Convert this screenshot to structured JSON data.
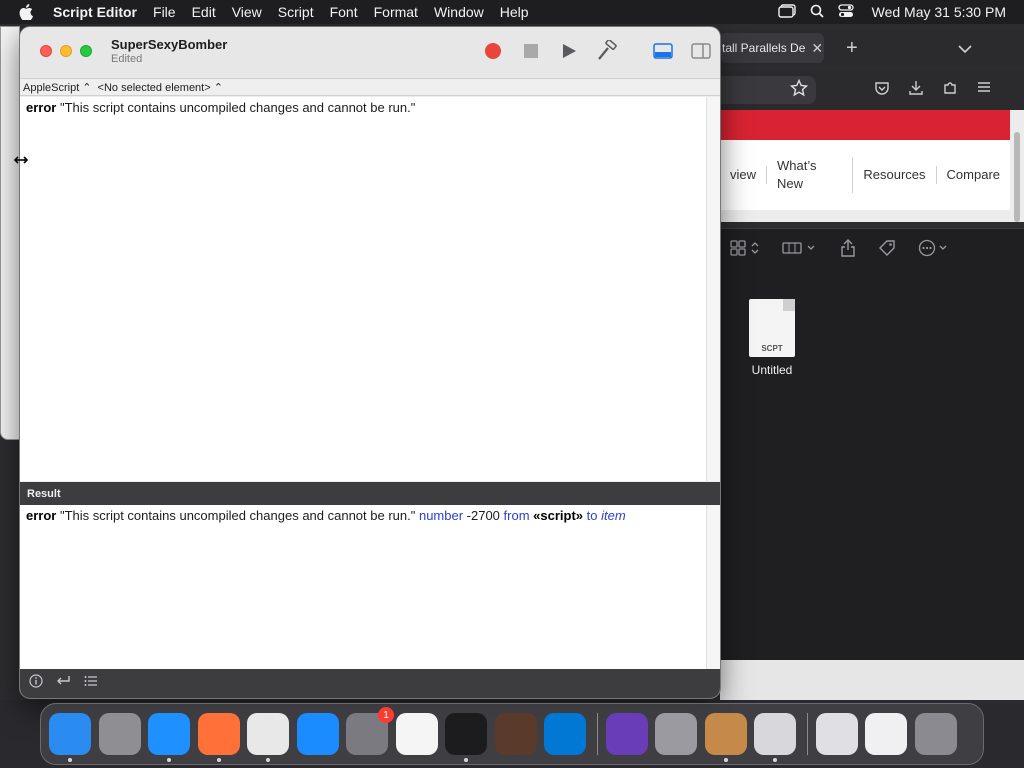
{
  "menubar": {
    "app_name": "Script Editor",
    "items": [
      "File",
      "Edit",
      "View",
      "Script",
      "Font",
      "Format",
      "Window",
      "Help"
    ],
    "status_icons": [
      "window-icon",
      "search-icon",
      "control-center-icon"
    ],
    "clock": "Wed May 31  5:30 PM"
  },
  "safari": {
    "tab_title": "tall Parallels De",
    "tab_close": "✕",
    "new_tab": "+",
    "nav_links": [
      "view",
      "What’s New",
      "Resources",
      "Compare"
    ]
  },
  "finder": {
    "file_name": "Untitled",
    "file_type": "SCPT"
  },
  "script_editor": {
    "title": "SuperSexyBomber",
    "subtitle": "Edited",
    "language_popup": "AppleScript ⌃",
    "element_popup": "<No selected element> ⌃",
    "editor_line": {
      "keyword": "error",
      "message": " \"This script contains uncompiled changes and cannot be run.\""
    },
    "result_header": "Result",
    "result_line": {
      "keyword": "error",
      "message": " \"This script contains uncompiled changes and cannot be run.\" ",
      "number_label": "number",
      "number_value": " -2700 ",
      "from_label": "from",
      "script_token": "«script»",
      "to_label": "to",
      "item_label": "item"
    }
  },
  "dock": {
    "apps": [
      {
        "name": "Finder",
        "color": "#2a8cf0",
        "running": true
      },
      {
        "name": "Launchpad",
        "color": "#8e8e93",
        "running": false
      },
      {
        "name": "Safari",
        "color": "#1e90ff",
        "running": true
      },
      {
        "name": "Firefox",
        "color": "#ff7139",
        "running": true
      },
      {
        "name": "Chrome",
        "color": "#e8e8e8",
        "running": true
      },
      {
        "name": "App Store",
        "color": "#1a8cff",
        "running": false
      },
      {
        "name": "System Settings",
        "color": "#7a7a80",
        "running": false,
        "badge": "1"
      },
      {
        "name": "TextEdit",
        "color": "#f5f5f5",
        "running": false
      },
      {
        "name": "Terminal",
        "color": "#1c1c1e",
        "running": true
      },
      {
        "name": "GarageBand",
        "color": "#5a3a2a",
        "running": false
      },
      {
        "name": "Visual Studio Code",
        "color": "#0078d4",
        "running": false
      }
    ],
    "apps2": [
      {
        "name": "Visual Studio",
        "color": "#6a3db8",
        "running": false
      },
      {
        "name": "Boot Camp",
        "color": "#9a9aa0",
        "running": false
      },
      {
        "name": "Installer",
        "color": "#c58a4a",
        "running": true
      },
      {
        "name": "Script Editor",
        "color": "#d8d8dc",
        "running": true
      }
    ],
    "docs": [
      {
        "name": "document-stack",
        "color": "#e0e0e4"
      },
      {
        "name": "downloads-stack",
        "color": "#f0f0f2"
      },
      {
        "name": "Trash",
        "color": "#8a8a90"
      }
    ]
  }
}
